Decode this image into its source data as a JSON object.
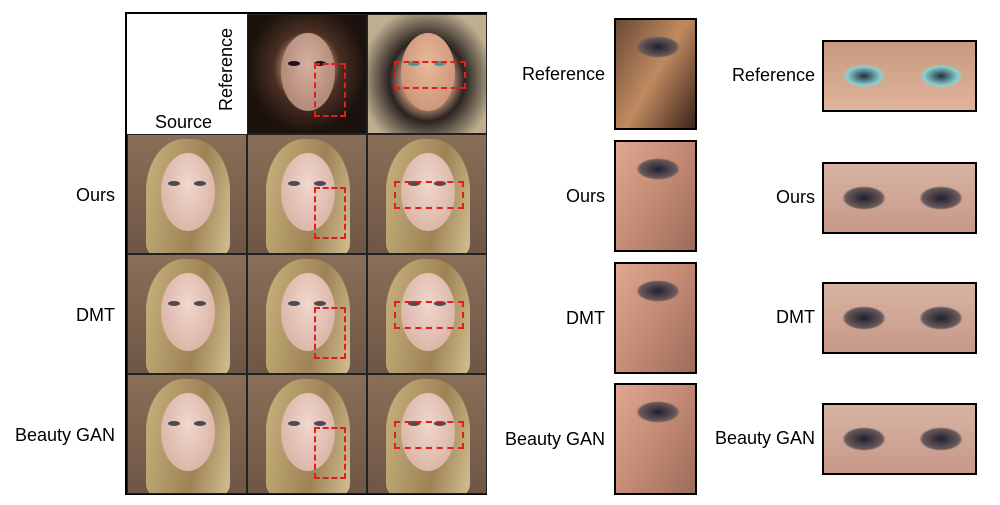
{
  "grid": {
    "source_label": "Source",
    "reference_label": "Reference",
    "rows": [
      "Ours",
      "DMT",
      "Beauty GAN"
    ]
  },
  "middle": {
    "labels": [
      "Reference",
      "Ours",
      "DMT",
      "Beauty GAN"
    ]
  },
  "right": {
    "labels": [
      "Reference",
      "Ours",
      "DMT",
      "Beauty GAN"
    ]
  },
  "colors": {
    "box": "#e02020"
  }
}
